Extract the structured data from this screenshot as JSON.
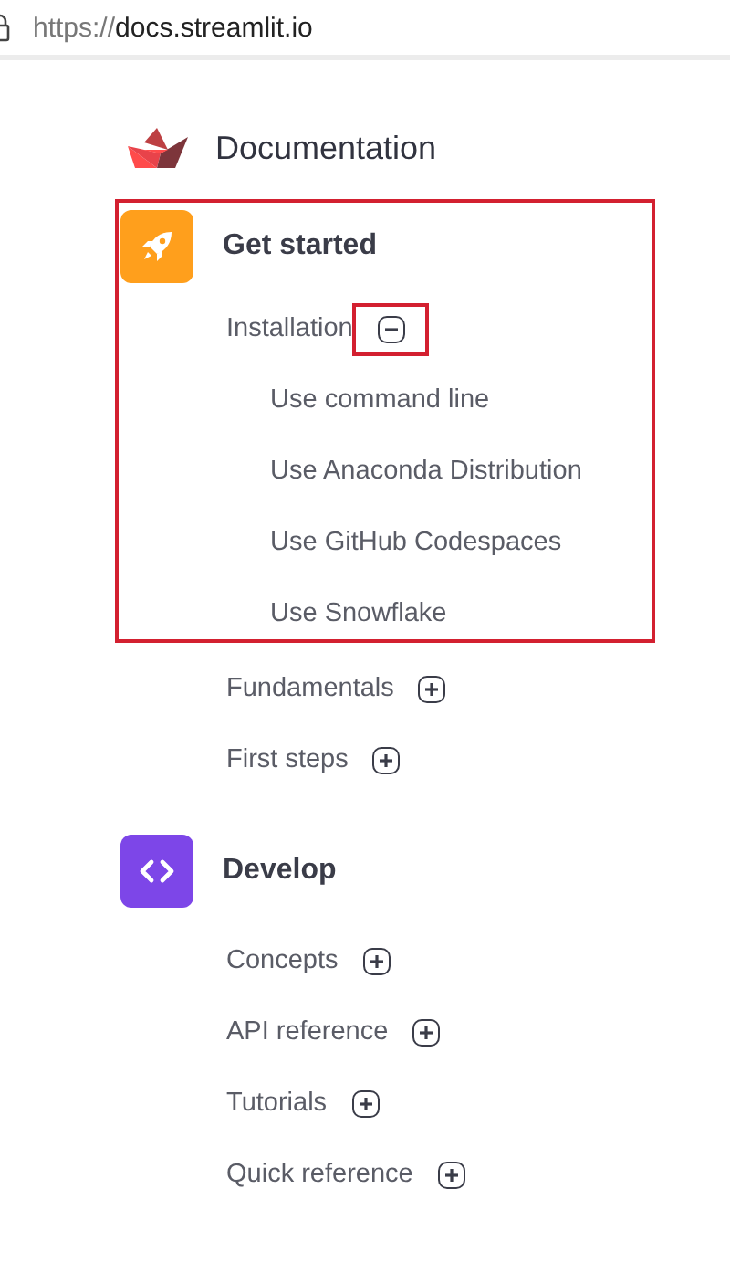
{
  "address_bar": {
    "scheme": "https://",
    "host": "docs.streamlit.io"
  },
  "header": {
    "title": "Documentation"
  },
  "sections": [
    {
      "title": "Get started",
      "kind": "rocket",
      "color": "#ff9f1c",
      "highlighted": true,
      "items": [
        {
          "label": "Installation",
          "expanded": true,
          "highlighted": true,
          "toggle_highlighted": true,
          "children": [
            {
              "label": "Use command line"
            },
            {
              "label": "Use Anaconda Distribution"
            },
            {
              "label": "Use GitHub Codespaces"
            },
            {
              "label": "Use Snowflake"
            }
          ]
        },
        {
          "label": "Fundamentals",
          "expanded": false,
          "highlighted": false,
          "toggle_highlighted": false
        },
        {
          "label": "First steps",
          "expanded": false,
          "highlighted": false,
          "toggle_highlighted": false
        }
      ]
    },
    {
      "title": "Develop",
      "kind": "code",
      "color": "#7d46e8",
      "highlighted": false,
      "items": [
        {
          "label": "Concepts",
          "expanded": false,
          "highlighted": false,
          "toggle_highlighted": false
        },
        {
          "label": "API reference",
          "expanded": false,
          "highlighted": false,
          "toggle_highlighted": false
        },
        {
          "label": "Tutorials",
          "expanded": false,
          "highlighted": false,
          "toggle_highlighted": false
        },
        {
          "label": "Quick reference",
          "expanded": false,
          "highlighted": false,
          "toggle_highlighted": false
        }
      ]
    }
  ]
}
